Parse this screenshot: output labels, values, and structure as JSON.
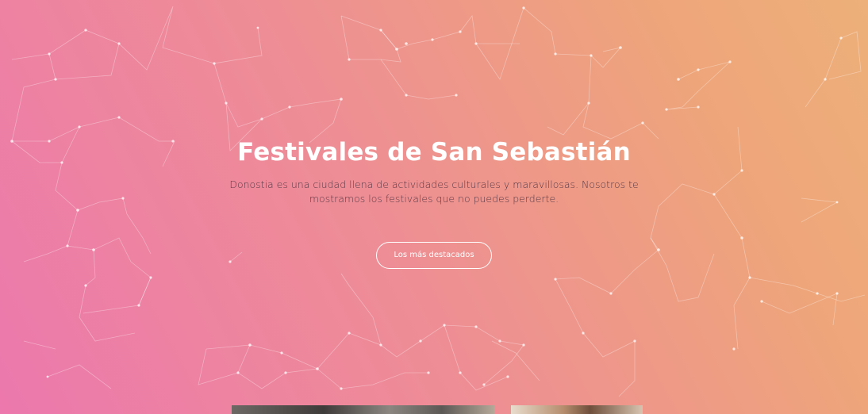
{
  "hero": {
    "title": "Festivales de San Sebastián",
    "description": "Donostia es una ciudad llena de actividades culturales y maravillosas. Nosotros te mostramos los festivales que no puedes perderte.",
    "cta_label": "Los más destacados"
  },
  "colors": {
    "gradient_start": "#ec78ad",
    "gradient_end": "#edb07a",
    "title": "#ffffff",
    "description": "#5a3a46"
  }
}
